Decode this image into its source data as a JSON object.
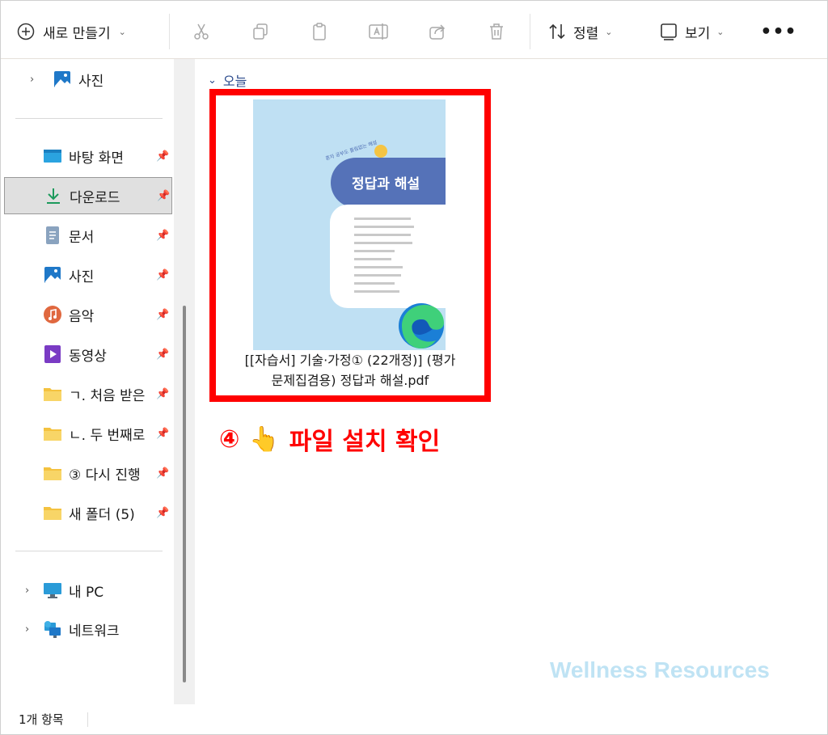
{
  "toolbar": {
    "new_label": "새로 만들기",
    "sort_label": "정렬",
    "view_label": "보기",
    "more_label": "•••"
  },
  "sidebar": {
    "top_items": [
      {
        "label": "사진"
      }
    ],
    "quick_access": [
      {
        "label": "바탕 화면",
        "icon": "desktop-icon"
      },
      {
        "label": "다운로드",
        "icon": "download-icon"
      },
      {
        "label": "문서",
        "icon": "document-icon"
      },
      {
        "label": "사진",
        "icon": "pictures-icon"
      },
      {
        "label": "음악",
        "icon": "music-icon"
      },
      {
        "label": "동영상",
        "icon": "video-icon"
      },
      {
        "label": "ㄱ. 처음 받은",
        "icon": "folder-icon"
      },
      {
        "label": "ㄴ. 두 번째로",
        "icon": "folder-icon"
      },
      {
        "label": "③ 다시 진행",
        "icon": "folder-icon"
      },
      {
        "label": "새 폴더 (5)",
        "icon": "folder-icon"
      }
    ],
    "bottom_items": [
      {
        "label": "내 PC",
        "icon": "pc-icon"
      },
      {
        "label": "네트워크",
        "icon": "network-icon"
      }
    ],
    "selected": "다운로드"
  },
  "content": {
    "group_label": "오늘",
    "file": {
      "name_line1": "[[자습서] 기술·가정① (22개정)] (평가",
      "name_line2": "문제집겸용) 정답과 해설.pdf",
      "thumbnail_title": "정답과 해설",
      "thumbnail_subtitle": "혼자 공부도 틀림없는 해설"
    },
    "callout": {
      "number": "④",
      "emoji": "👆",
      "text": "파일 설치 확인"
    },
    "watermark": "Wellness Resources"
  },
  "status": {
    "item_count": "1개 항목"
  },
  "colors": {
    "highlight": "#ff0000",
    "callout_text": "#ff0000",
    "watermark": "#bfe3f4",
    "thumbnail_bg": "#bfe0f3",
    "thumbnail_band": "#5572b8"
  }
}
